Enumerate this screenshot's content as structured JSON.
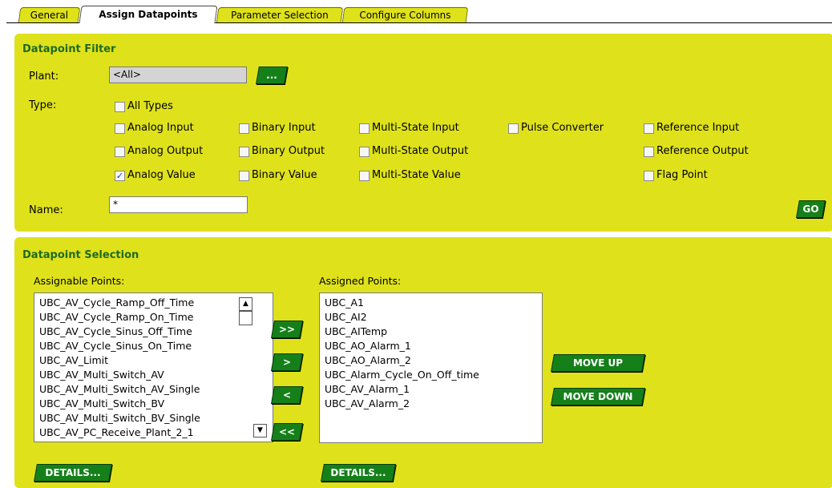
{
  "tabs": [
    {
      "label": "General"
    },
    {
      "label": "Assign Datapoints"
    },
    {
      "label": "Parameter Selection"
    },
    {
      "label": "Configure Columns"
    }
  ],
  "filter": {
    "title": "Datapoint Filter",
    "plant_label": "Plant:",
    "plant_value": "<All>",
    "plant_button": "...",
    "type_label": "Type:",
    "all_types": "All Types",
    "types": {
      "analog_input": "Analog Input",
      "analog_output": "Analog Output",
      "analog_value": "Analog Value",
      "binary_input": "Binary Input",
      "binary_output": "Binary Output",
      "binary_value": "Binary Value",
      "multistate_input": "Multi-State Input",
      "multistate_output": "Multi-State Output",
      "multistate_value": "Multi-State Value",
      "pulse_converter": "Pulse Converter",
      "reference_input": "Reference Input",
      "reference_output": "Reference Output",
      "flag_point": "Flag Point"
    },
    "checked_mark": "✓",
    "name_label": "Name:",
    "name_value": "*",
    "go_button": "GO"
  },
  "selection": {
    "title": "Datapoint Selection",
    "assignable_label": "Assignable Points:",
    "assigned_label": "Assigned Points:",
    "assignable_points": [
      "UBC_AV_Cycle_Ramp_Off_Time",
      "UBC_AV_Cycle_Ramp_On_Time",
      "UBC_AV_Cycle_Sinus_Off_Time",
      "UBC_AV_Cycle_Sinus_On_Time",
      "UBC_AV_Limit",
      "UBC_AV_Multi_Switch_AV",
      "UBC_AV_Multi_Switch_AV_Single",
      "UBC_AV_Multi_Switch_BV",
      "UBC_AV_Multi_Switch_BV_Single",
      "UBC_AV_PC_Receive_Plant_2_1"
    ],
    "assigned_points": [
      "UBC_A1",
      "UBC_AI2",
      "UBC_AITemp",
      "UBC_AO_Alarm_1",
      "UBC_AO_Alarm_2",
      "UBC_Alarm_Cycle_On_Off_time",
      "UBC_AV_Alarm_1",
      "UBC_AV_Alarm_2"
    ],
    "btn_add_all": ">>",
    "btn_add": ">",
    "btn_remove": "<",
    "btn_remove_all": "<<",
    "move_up": "MOVE UP",
    "move_down": "MOVE DOWN",
    "details_left": "DETAILS...",
    "details_right": "DETAILS..."
  },
  "colors": {
    "panel": "#dfe21a",
    "button": "#15801a",
    "title": "#1f6a1f"
  }
}
